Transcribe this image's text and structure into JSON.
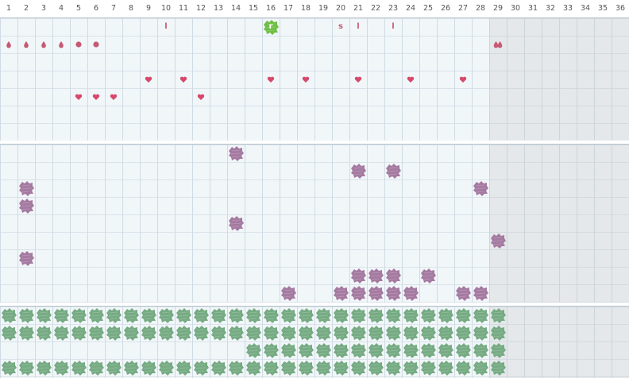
{
  "days": [
    "1",
    "2",
    "3",
    "4",
    "5",
    "6",
    "7",
    "8",
    "9",
    "10",
    "11",
    "12",
    "13",
    "14",
    "15",
    "16",
    "17",
    "18",
    "19",
    "20",
    "21",
    "22",
    "23",
    "24",
    "25",
    "26",
    "27",
    "28",
    "29",
    "30",
    "31",
    "32",
    "33",
    "34",
    "35",
    "36"
  ],
  "colors": {
    "marker": "#c65a74",
    "heart": "#d6496b",
    "green_badge": "#6fbe45",
    "purple_blob": "#a57aa1",
    "green_blob": "#76ab83"
  },
  "section1": {
    "row0_marks": [
      {
        "day": 10,
        "text": "l"
      },
      {
        "day": 16,
        "text": "r",
        "badge": true
      },
      {
        "day": 20,
        "text": "s"
      },
      {
        "day": 21,
        "text": "l"
      },
      {
        "day": 23,
        "text": "l"
      }
    ],
    "row1_marks": [
      {
        "day": 1,
        "type": "drop"
      },
      {
        "day": 2,
        "type": "drop"
      },
      {
        "day": 3,
        "type": "drop"
      },
      {
        "day": 4,
        "type": "drop"
      },
      {
        "day": 5,
        "type": "dot"
      },
      {
        "day": 6,
        "type": "dot"
      },
      {
        "day": 29,
        "type": "drops"
      }
    ],
    "hearts": [
      {
        "day": 5,
        "row": 4
      },
      {
        "day": 6,
        "row": 4
      },
      {
        "day": 7,
        "row": 4
      },
      {
        "day": 9,
        "row": 3
      },
      {
        "day": 11,
        "row": 3
      },
      {
        "day": 12,
        "row": 4
      },
      {
        "day": 16,
        "row": 3
      },
      {
        "day": 18,
        "row": 3
      },
      {
        "day": 21,
        "row": 3
      },
      {
        "day": 24,
        "row": 3
      },
      {
        "day": 27,
        "row": 3
      }
    ]
  },
  "section2": {
    "blobs": [
      {
        "day": 14,
        "row": 0
      },
      {
        "day": 21,
        "row": 1
      },
      {
        "day": 23,
        "row": 1
      },
      {
        "day": 2,
        "row": 2
      },
      {
        "day": 28,
        "row": 2
      },
      {
        "day": 2,
        "row": 3
      },
      {
        "day": 14,
        "row": 4
      },
      {
        "day": 29,
        "row": 5
      },
      {
        "day": 2,
        "row": 6
      },
      {
        "day": 21,
        "row": 7
      },
      {
        "day": 22,
        "row": 7
      },
      {
        "day": 23,
        "row": 7
      },
      {
        "day": 25,
        "row": 7
      },
      {
        "day": 17,
        "row": 8
      },
      {
        "day": 20,
        "row": 8
      },
      {
        "day": 21,
        "row": 8
      },
      {
        "day": 22,
        "row": 8
      },
      {
        "day": 23,
        "row": 8
      },
      {
        "day": 24,
        "row": 8
      },
      {
        "day": 27,
        "row": 8
      },
      {
        "day": 28,
        "row": 8
      }
    ]
  },
  "section3": {
    "rows": [
      {
        "from": 1,
        "to": 29
      },
      {
        "from": 1,
        "to": 29
      },
      {
        "from": 15,
        "to": 29
      },
      {
        "from": 1,
        "to": 29
      }
    ]
  }
}
